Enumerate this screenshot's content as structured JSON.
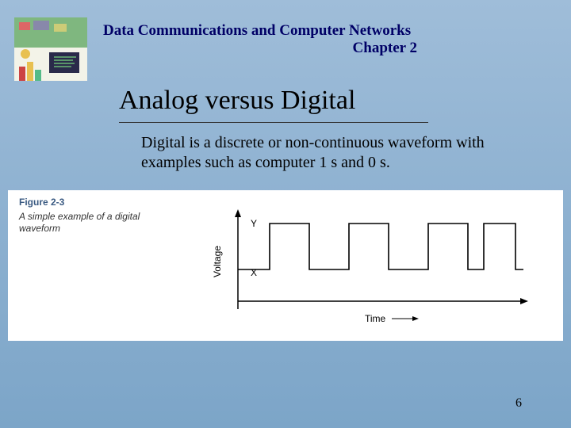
{
  "header": {
    "course_title": "Data Communications and Computer Networks",
    "chapter": "Chapter 2"
  },
  "heading": "Analog versus Digital",
  "body": "Digital is a discrete or non-continuous waveform with examples such as computer 1 s and 0 s.",
  "figure": {
    "label": "Figure 2-3",
    "caption": "A simple example of a digital waveform",
    "y_axis": "Voltage",
    "x_axis": "Time",
    "y_high": "Y",
    "y_low": "X"
  },
  "page_number": "6",
  "chart_data": {
    "type": "line",
    "title": "A simple example of a digital waveform",
    "xlabel": "Time",
    "ylabel": "Voltage",
    "y_levels": {
      "low": "X",
      "high": "Y"
    },
    "sequence": [
      "low",
      "high",
      "low",
      "high",
      "low",
      "high",
      "low",
      "high",
      "low"
    ],
    "note": "Square wave alternating between two discrete voltage levels X (low) and Y (high); four high pulses shown."
  }
}
